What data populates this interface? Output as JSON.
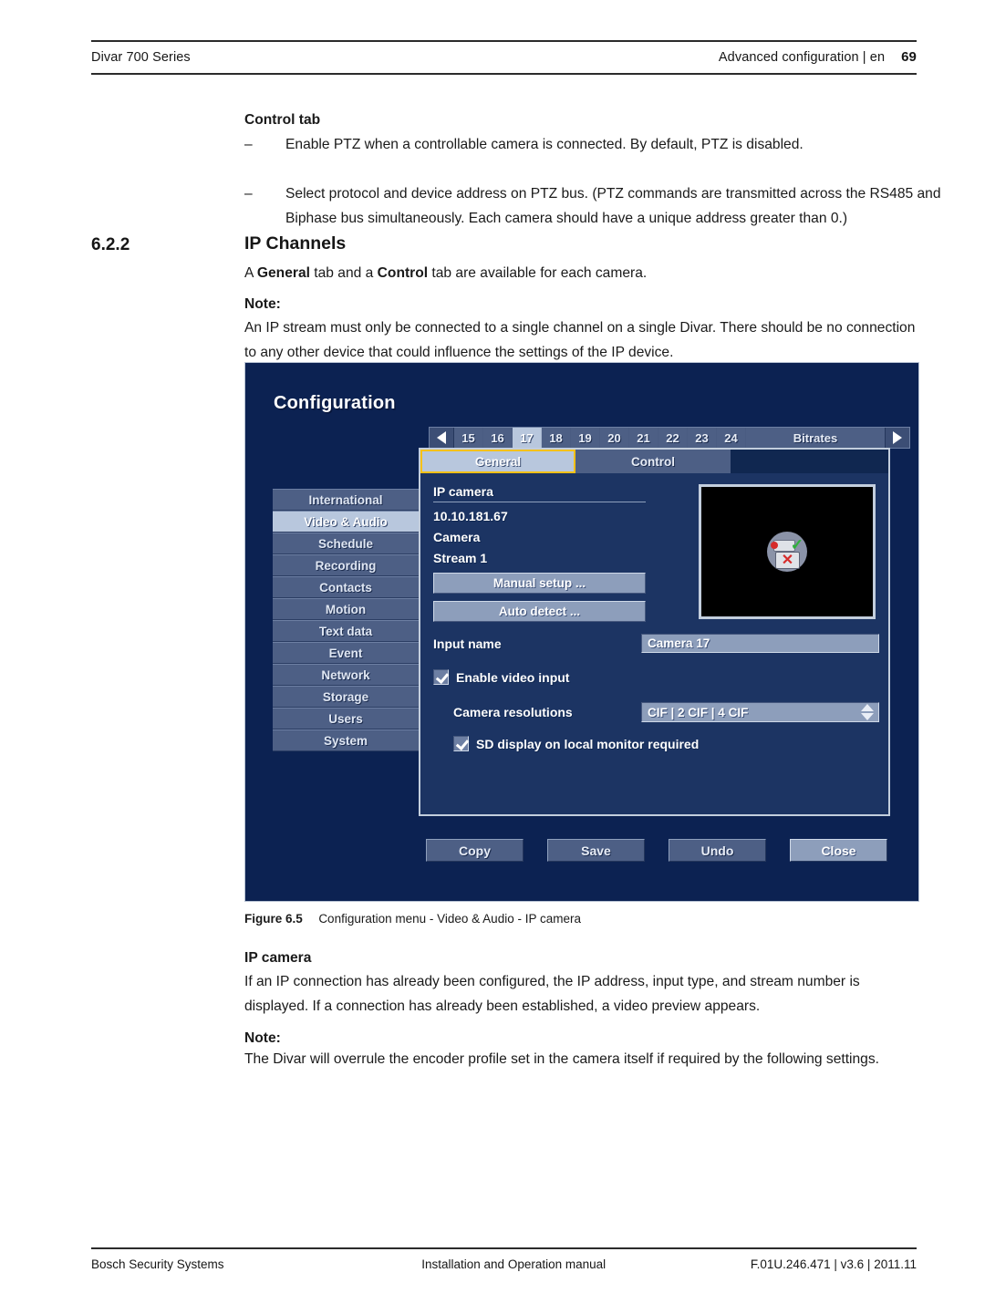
{
  "header": {
    "left": "Divar 700 Series",
    "right": "Advanced configuration | en",
    "page_number": "69"
  },
  "body": {
    "control_tab_heading": "Control tab",
    "bullet_dash": "–",
    "bullet_1": "Enable PTZ when a controllable camera is connected. By default, PTZ is disabled.",
    "bullet_2": "Select protocol and device address on PTZ bus. (PTZ commands are transmitted across the RS485 and Biphase bus simultaneously. Each camera should have a unique address greater than 0.)",
    "section_number": "6.2.2",
    "section_title": "IP Channels",
    "intro_a": "A ",
    "intro_general": "General",
    "intro_b": " tab and a ",
    "intro_control": "Control",
    "intro_c": " tab are available for each camera.",
    "note_label_1": "Note:",
    "note_text_1": "An IP stream must only be connected to a single channel on a single Divar. There should be no connection to any other device that could influence the settings of the IP device.",
    "figure_number": "Figure 6.5",
    "figure_caption": "Configuration menu - Video & Audio - IP camera",
    "ipcamera_heading": "IP camera",
    "ipcamera_text": "If an IP connection has already been configured, the IP address, input type, and stream number is displayed. If a connection has already been established, a video preview appears.",
    "note_label_2": "Note:",
    "note_text_2": "The Divar will overrule the encoder profile set in the camera itself if required by the following settings."
  },
  "screenshot": {
    "title": "Configuration",
    "channel_bar": {
      "prev_icon": "left-triangle-icon",
      "next_icon": "right-triangle-icon",
      "channels": [
        "15",
        "16",
        "17",
        "18",
        "19",
        "20",
        "21",
        "22",
        "23",
        "24"
      ],
      "selected_channel": "17",
      "bitrates_label": "Bitrates"
    },
    "tabs": [
      {
        "label": "General",
        "active": true
      },
      {
        "label": "Control",
        "active": false
      }
    ],
    "sidebar": [
      {
        "label": "International",
        "selected": false
      },
      {
        "label": "Video & Audio",
        "selected": true
      },
      {
        "label": "Schedule",
        "selected": false
      },
      {
        "label": "Recording",
        "selected": false
      },
      {
        "label": "Contacts",
        "selected": false
      },
      {
        "label": "Motion",
        "selected": false
      },
      {
        "label": "Text data",
        "selected": false
      },
      {
        "label": "Event",
        "selected": false
      },
      {
        "label": "Network",
        "selected": false
      },
      {
        "label": "Storage",
        "selected": false
      },
      {
        "label": "Users",
        "selected": false
      },
      {
        "label": "System",
        "selected": false
      }
    ],
    "form": {
      "ipcamera_group": "IP camera",
      "ip_address": "10.10.181.67",
      "input_type": "Camera",
      "stream": "Stream 1",
      "manual_setup_button": "Manual setup ...",
      "auto_detect_button": "Auto detect ...",
      "input_name_label": "Input name",
      "input_name_value": "Camera 17",
      "enable_video_input_label": "Enable video input",
      "enable_video_input_checked": true,
      "camera_resolutions_label": "Camera resolutions",
      "camera_resolutions_value": "CIF | 2 CIF | 4 CIF",
      "sd_display_label": "SD display on local monitor required",
      "sd_display_checked": true,
      "preview_icon": "camera-ok-monitor-error-icon"
    },
    "buttons": [
      {
        "label": "Copy",
        "highlighted": false
      },
      {
        "label": "Save",
        "highlighted": false
      },
      {
        "label": "Undo",
        "highlighted": false
      },
      {
        "label": "Close",
        "highlighted": true
      }
    ]
  },
  "footer": {
    "left": "Bosch Security Systems",
    "middle": "Installation and Operation manual",
    "right": "F.01U.246.471 | v3.6 | 2011.11"
  },
  "colors": {
    "dialog_bg": "#0c2252",
    "panel_bg": "#1c3463",
    "accent_selected": "#b8c7dd",
    "tab_focus_outline": "#f5c117",
    "control_bg": "#4d5f85"
  }
}
